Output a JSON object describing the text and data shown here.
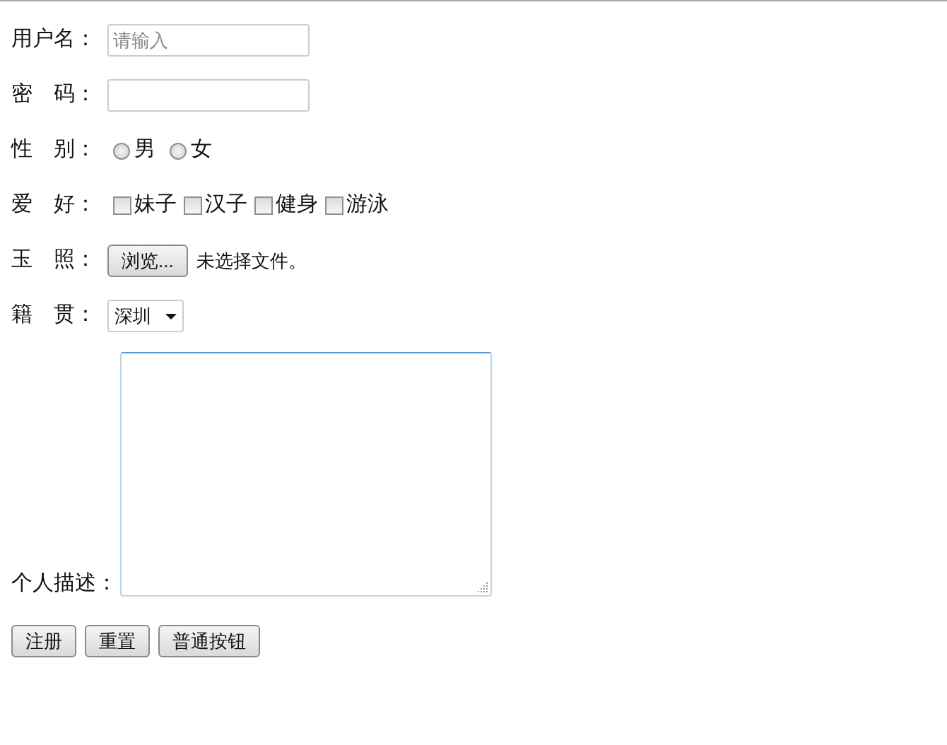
{
  "fields": [
    {
      "kind": "text",
      "label": "用户名：",
      "placeholder": "请输入"
    },
    {
      "kind": "password",
      "label": "密　码："
    },
    {
      "kind": "radio",
      "label": "性　别：",
      "options": [
        {
          "label": "男",
          "selected": false
        },
        {
          "label": "女",
          "selected": false
        }
      ]
    },
    {
      "kind": "checkbox",
      "label": "爱　好：",
      "options": [
        {
          "label": "妹子",
          "checked": false
        },
        {
          "label": "汉子",
          "checked": false
        },
        {
          "label": "健身",
          "checked": false
        },
        {
          "label": "游泳",
          "checked": false
        }
      ]
    },
    {
      "kind": "file",
      "label": "玉　照：",
      "button": "浏览...",
      "status": "未选择文件。"
    },
    {
      "kind": "select",
      "label": "籍　贯：",
      "value": "深圳"
    },
    {
      "kind": "textarea",
      "label": "个人描述："
    }
  ],
  "buttons": [
    "注册",
    "重置",
    "普通按钮"
  ]
}
